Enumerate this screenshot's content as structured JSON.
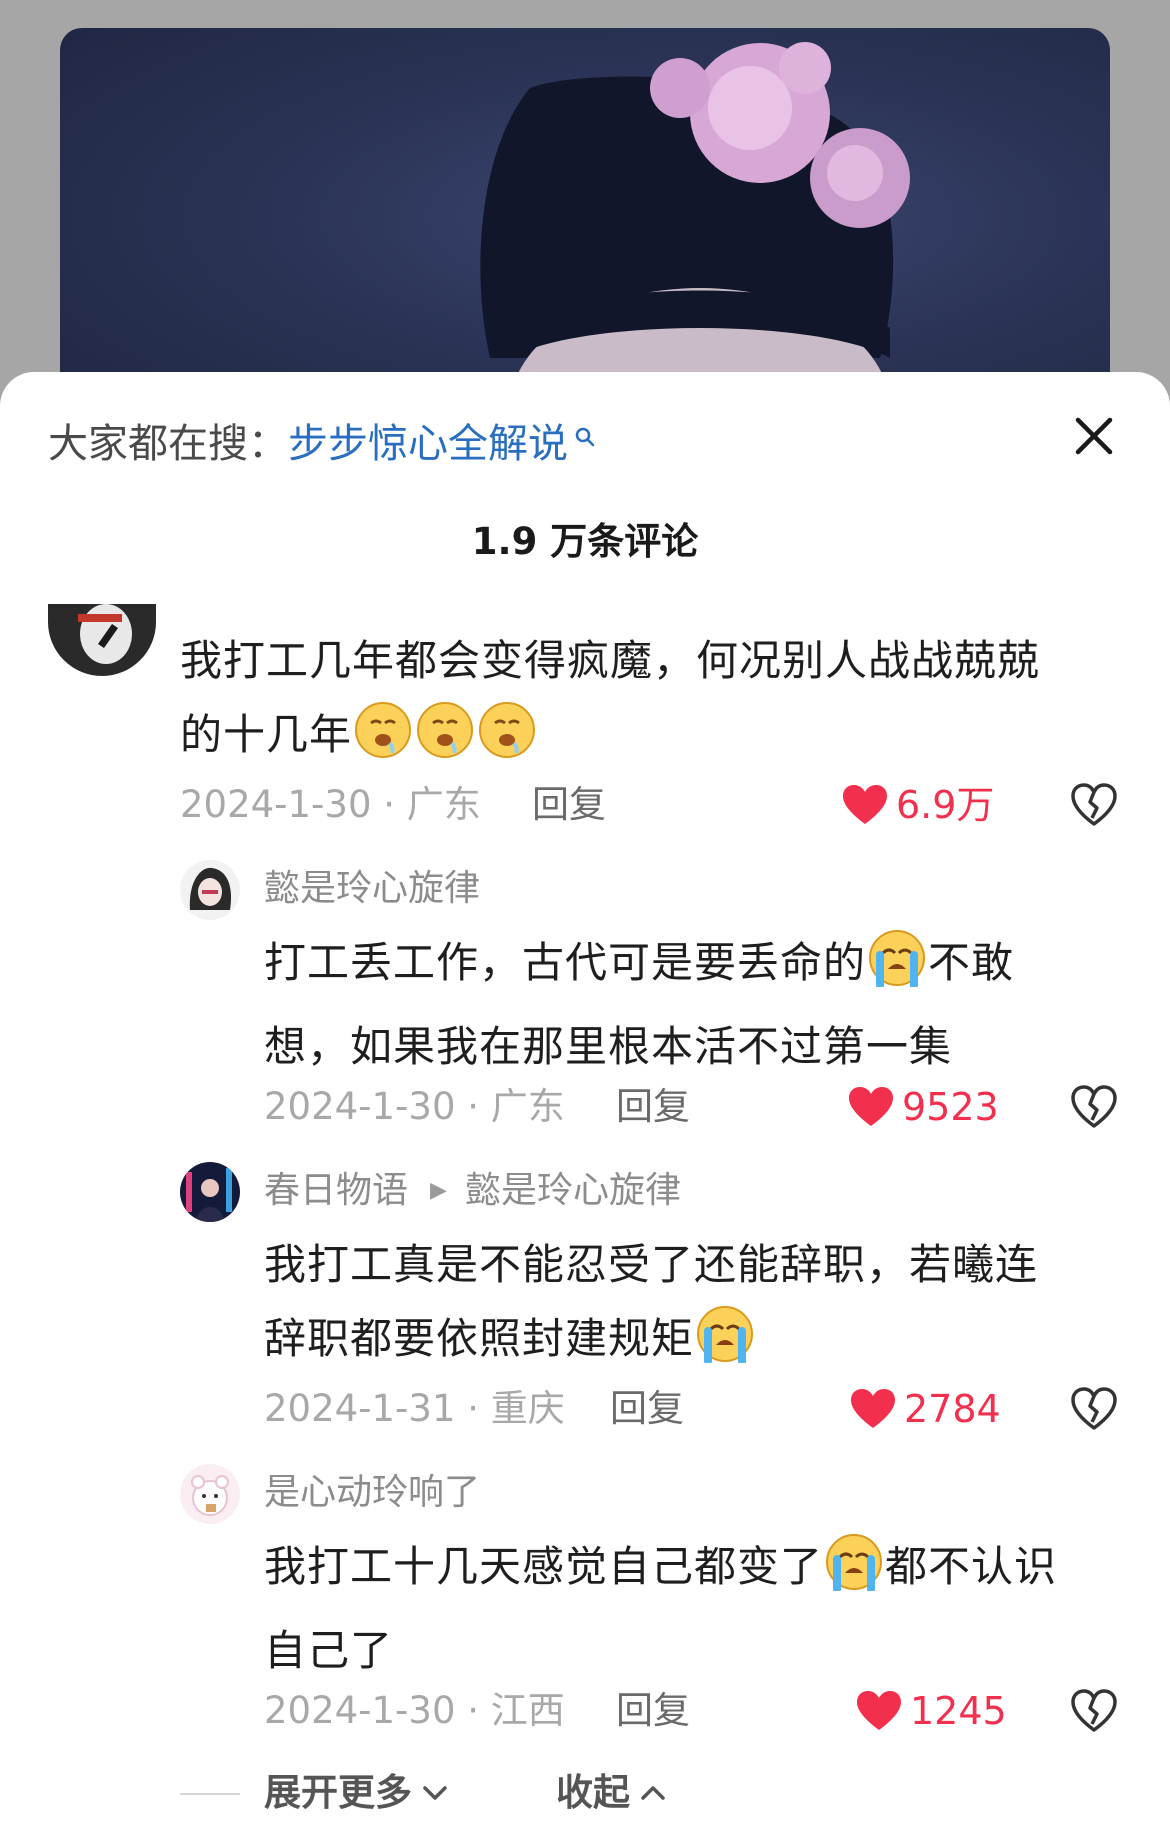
{
  "search": {
    "prefix": "大家都在搜：",
    "term": "步步惊心全解说"
  },
  "header": {
    "comment_count": "1.9 万条评论"
  },
  "colors": {
    "like_red": "#f2304d",
    "link_blue": "#2a6ebf",
    "meta_gray": "#a8a8a8"
  },
  "comments": [
    {
      "text_line1": "我打工几年都会变得疯魔，何况别人战战兢兢",
      "text_line2": "的十几年",
      "emoji": "drooling-face",
      "date_location": "2024-1-30 · 广东",
      "reply_label": "回复",
      "likes": "6.9万"
    }
  ],
  "replies": [
    {
      "author": "懿是玲心旋律",
      "text_line1a": "打工丢工作，古代可是要丢命的",
      "text_line1b": "不敢",
      "text_line2": "想，如果我在那里根本活不过第一集",
      "emoji": "loudly-crying-face",
      "date_location": "2024-1-30 · 广东",
      "reply_label": "回复",
      "likes": "9523"
    },
    {
      "author": "春日物语",
      "reply_to": "懿是玲心旋律",
      "text_line1": "我打工真是不能忍受了还能辞职，若曦连",
      "text_line2": "辞职都要依照封建规矩",
      "emoji": "loudly-crying-face",
      "date_location": "2024-1-31 · 重庆",
      "reply_label": "回复",
      "likes": "2784"
    },
    {
      "author": "是心动玲响了",
      "text_line1a": "我打工十几天感觉自己都变了",
      "text_line1b": "都不认识",
      "text_line2": "自己了",
      "emoji": "loudly-crying-face",
      "date_location": "2024-1-30 · 江西",
      "reply_label": "回复",
      "likes": "1245"
    }
  ],
  "footer": {
    "expand_label": "展开更多",
    "collapse_label": "收起"
  }
}
